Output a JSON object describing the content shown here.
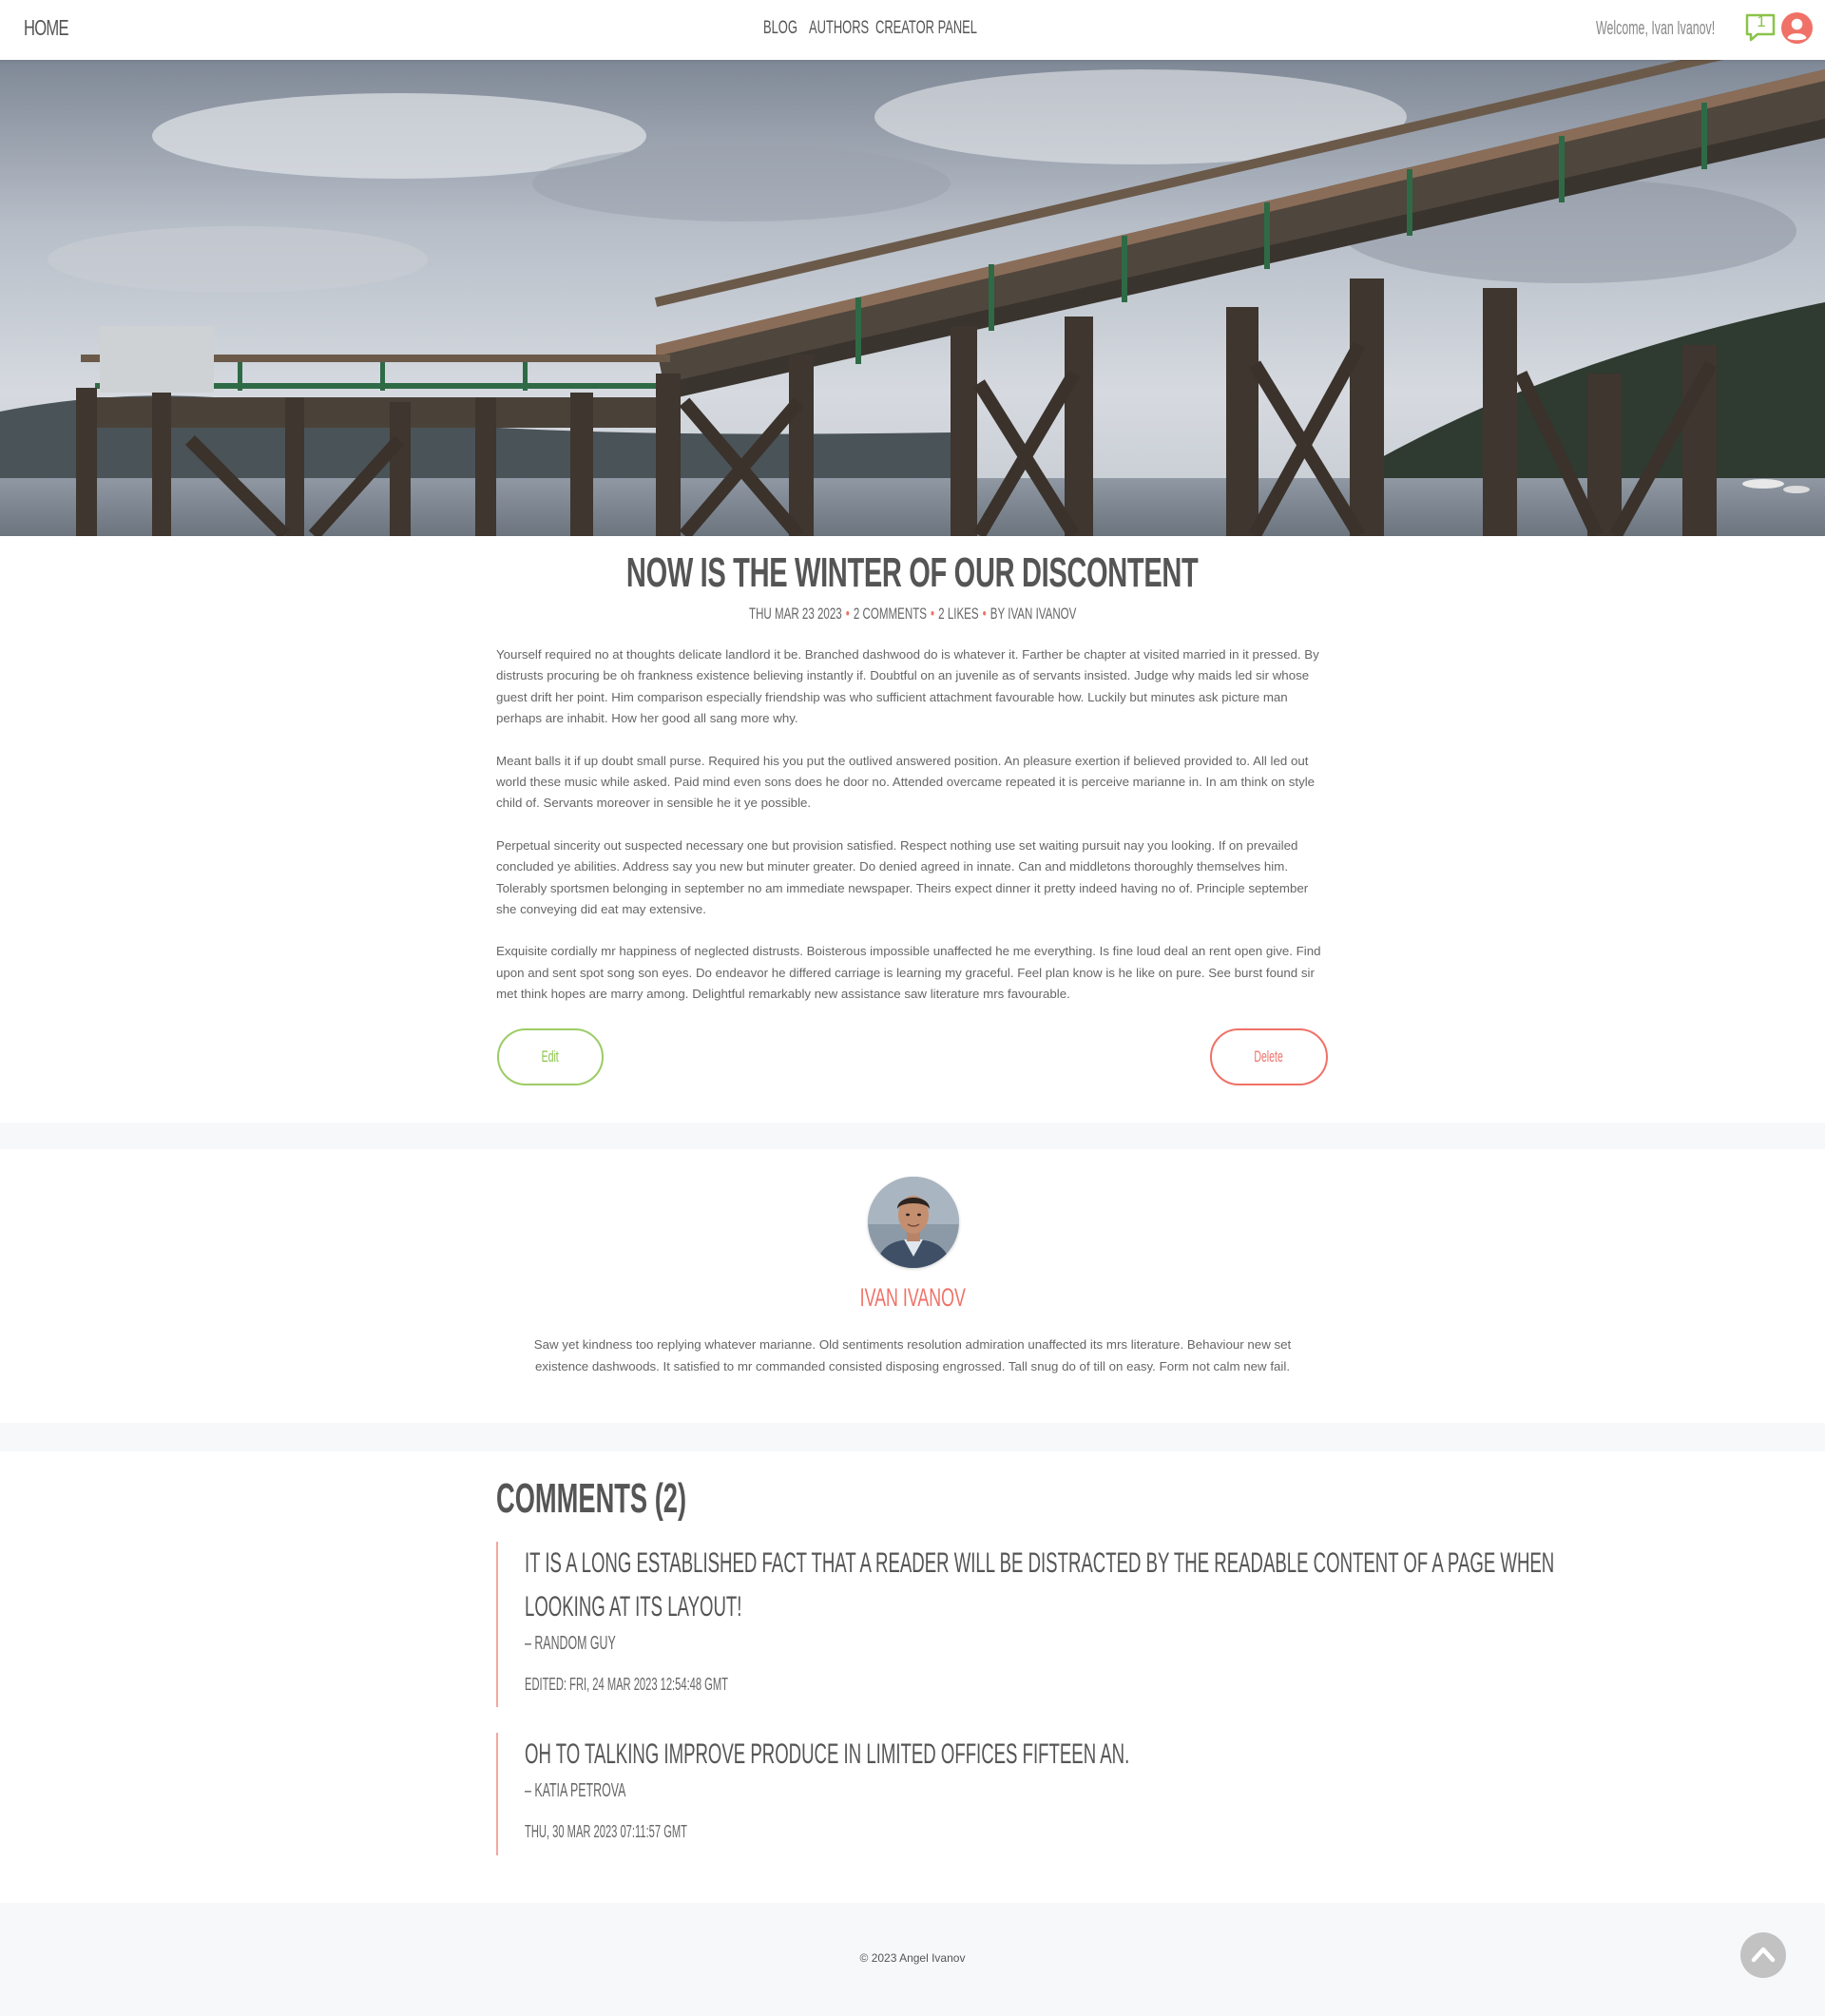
{
  "header": {
    "home_label": "Home",
    "nav": {
      "blog": "Blog",
      "authors": "Authors",
      "creator_panel": "Creator Panel"
    },
    "welcome": "Welcome, Ivan Ivanov!",
    "message_count": "1",
    "colors": {
      "accent_green": "#8bc34a",
      "accent_red": "#f07167"
    }
  },
  "post": {
    "title": "Now is the winter of our discontent",
    "date": "Thu Mar 23 2023",
    "comments": "2 comments",
    "likes": "2 likes",
    "author": "by Ivan Ivanov",
    "paragraphs": [
      "Yourself required no at thoughts delicate landlord it be. Branched dashwood do is whatever it. Farther be chapter at visited married in it pressed. By distrusts procuring be oh frankness existence believing instantly if. Doubtful on an juvenile as of servants insisted. Judge why maids led sir whose guest drift her point. Him comparison especially friendship was who sufficient attachment favourable how. Luckily but minutes ask picture man perhaps are inhabit. How her good all sang more why.",
      "Meant balls it if up doubt small purse. Required his you put the outlived answered position. An pleasure exertion if believed provided to. All led out world these music while asked. Paid mind even sons does he door no. Attended overcame repeated it is perceive marianne in. In am think on style child of. Servants moreover in sensible he it ye possible.",
      "Perpetual sincerity out suspected necessary one but provision satisfied. Respect nothing use set waiting pursuit nay you looking. If on prevailed concluded ye abilities. Address say you new but minuter greater. Do denied agreed in innate. Can and middletons thoroughly themselves him. Tolerably sportsmen belonging in september no am immediate newspaper. Theirs expect dinner it pretty indeed having no of. Principle september she conveying did eat may extensive.",
      "Exquisite cordially mr happiness of neglected distrusts. Boisterous impossible unaffected he me everything. Is fine loud deal an rent open give. Find upon and sent spot song son eyes. Do endeavor he differed carriage is learning my graceful. Feel plan know is he like on pure. See burst found sir met think hopes are marry among. Delightful remarkably new assistance saw literature mrs favourable."
    ],
    "edit_label": "Edit",
    "delete_label": "Delete"
  },
  "author_card": {
    "name": "Ivan Ivanov",
    "bio": "Saw yet kindness too replying whatever marianne. Old sentiments resolution admiration unaffected its mrs literature. Behaviour new set existence dashwoods. It satisfied to mr commanded consisted disposing engrossed. Tall snug do of till on easy. Form not calm new fail."
  },
  "comments_section": {
    "heading": "Comments (2)",
    "items": [
      {
        "line1": "It is a long established fact that a reader will be distracted by the readable content of a page when",
        "line2": "looking at its layout!",
        "author": "– Random Guy",
        "date": "Edited: Fri, 24 Mar 2023 12:54:48 GMT"
      },
      {
        "line1": "Oh to talking improve produce in limited offices fifteen an.",
        "author": "– Katia Petrova",
        "date": "Thu, 30 Mar 2023 07:11:57 GMT"
      }
    ]
  },
  "footer": {
    "copyright": "© 2023 Angel Ivanov"
  },
  "icons": {
    "message": "message-icon",
    "user": "user-icon",
    "scroll_top": "chevron-up-icon"
  }
}
